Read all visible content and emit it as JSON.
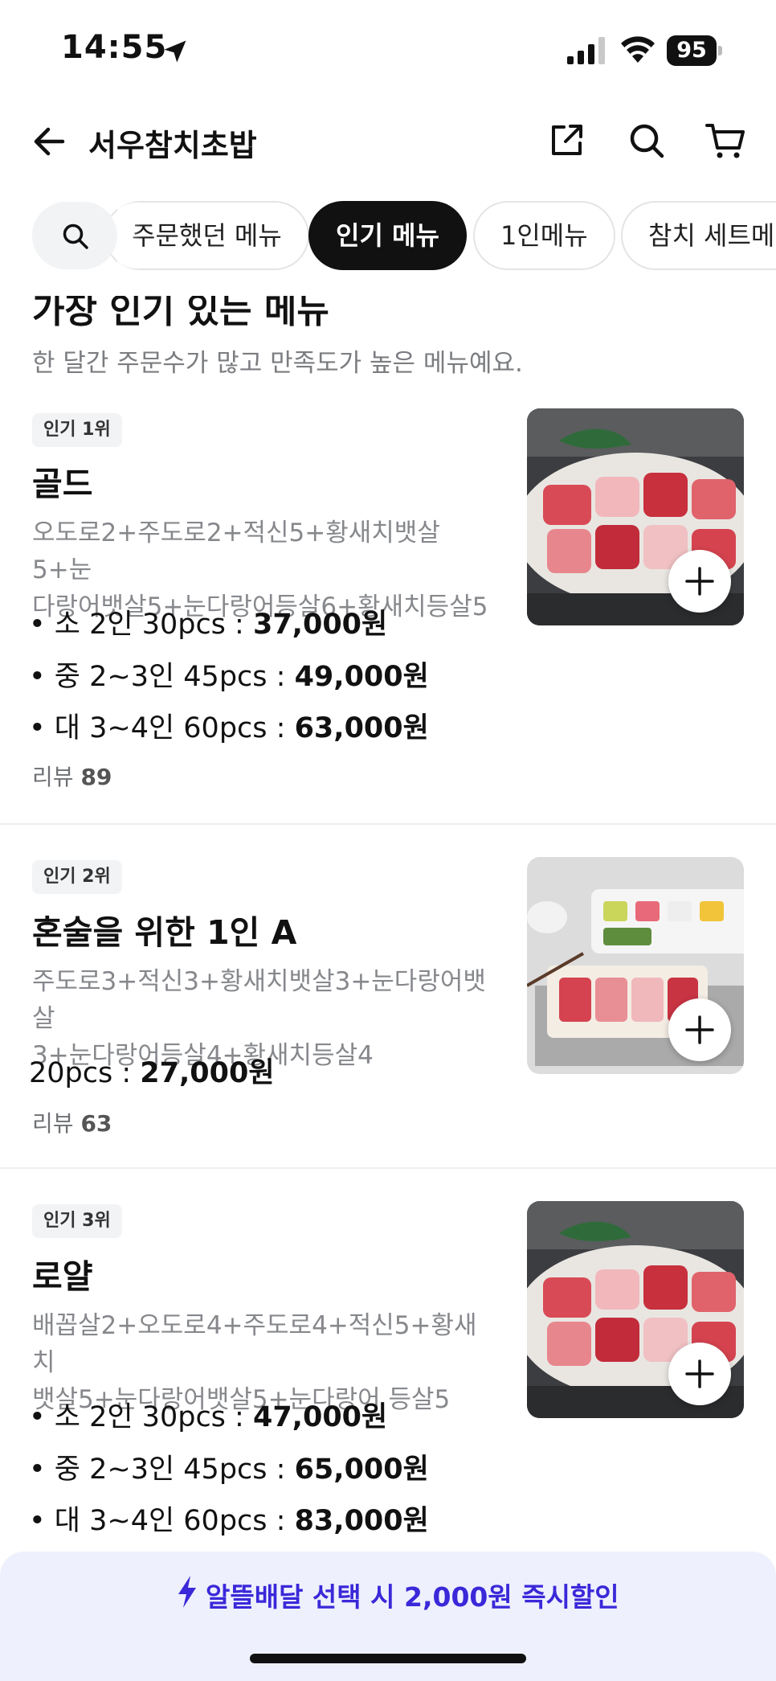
{
  "status_bar": {
    "time": "14:55",
    "battery": "95"
  },
  "header": {
    "title": "서우참치초밥"
  },
  "chips": [
    {
      "label": "주문했던 메뉴",
      "active": false
    },
    {
      "label": "인기 메뉴",
      "active": true
    },
    {
      "label": "1인메뉴",
      "active": false
    },
    {
      "label": "참치 세트메뉴",
      "active": false
    }
  ],
  "section": {
    "title": "가장 인기 있는 메뉴",
    "subtitle": "한 달간 주문수가 많고 만족도가 높은 메뉴예요."
  },
  "items": [
    {
      "rank": "인기 1위",
      "name": "골드",
      "desc_lines": [
        "오도로2+주도로2+적신5+황새치뱃살5+눈",
        "다랑어뱃살5+눈다랑어등살6+황새치등살5"
      ],
      "options": [
        {
          "label": "• 소 2인 30pcs : ",
          "price": "37,000원"
        },
        {
          "label": "• 중 2~3인 45pcs : ",
          "price": "49,000원"
        },
        {
          "label": "• 대 3~4인 60pcs : ",
          "price": "63,000원"
        }
      ],
      "review_label": "리뷰",
      "review_count": "89"
    },
    {
      "rank": "인기 2위",
      "name": "혼술을 위한 1인 A",
      "desc_lines": [
        "주도로3+적신3+황새치뱃살3+눈다랑어뱃살",
        "3+눈다랑어등살4+황새치등살4"
      ],
      "options": [
        {
          "label": "20pcs : ",
          "price": "27,000원"
        }
      ],
      "review_label": "리뷰",
      "review_count": "63"
    },
    {
      "rank": "인기 3위",
      "name": "로얄",
      "desc_lines": [
        "배꼽살2+오도로4+주도로4+적신5+황새치",
        "뱃살5+눈다랑어뱃살5+눈다랑어 등살5"
      ],
      "options": [
        {
          "label": "• 소 2인 30pcs : ",
          "price": "47,000원"
        },
        {
          "label": "• 중 2~3인 45pcs : ",
          "price": "65,000원"
        },
        {
          "label": "• 대 3~4인 60pcs : ",
          "price": "83,000원"
        }
      ]
    }
  ],
  "banner": {
    "text": "알뜰배달 선택 시 2,000원 즉시할인"
  },
  "colors": {
    "accent": "#3a28d9",
    "chip_active": "#111111",
    "banner_bg": "#eef0fd"
  }
}
